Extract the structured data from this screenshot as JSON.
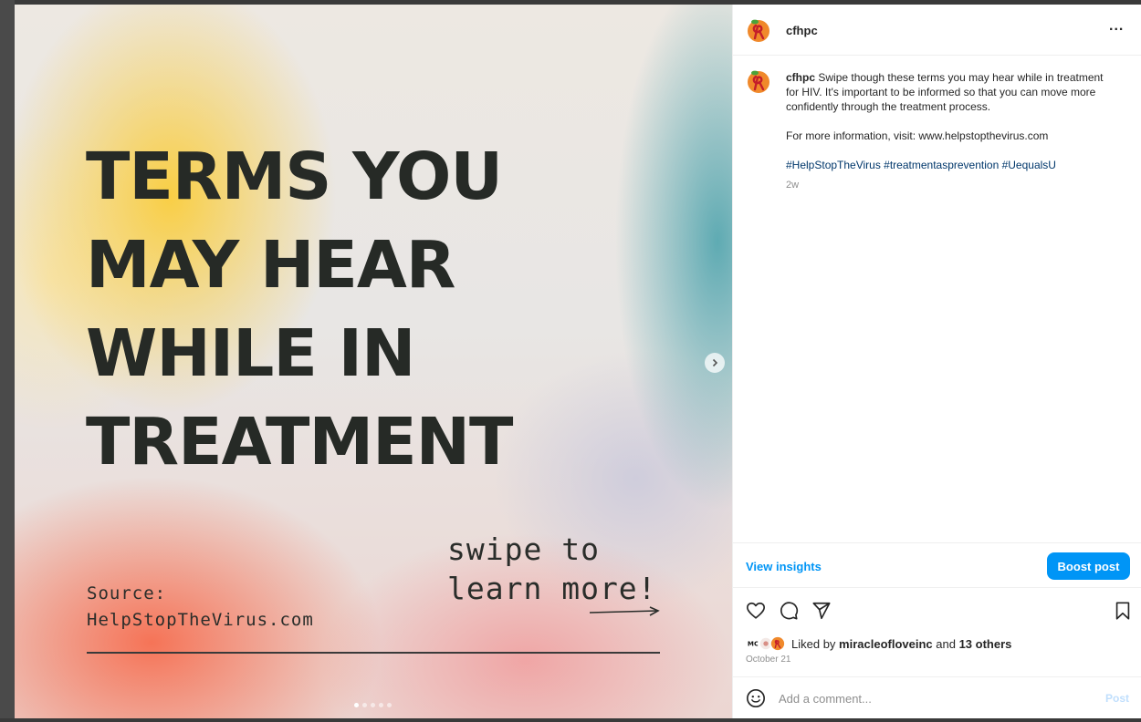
{
  "media": {
    "headline_lines": [
      "TERMS YOU",
      "MAY HEAR",
      "WHILE IN",
      "TREATMENT"
    ],
    "source_label": "Source:",
    "source_site": "HelpStopTheVirus.com",
    "swipe_lines": [
      "swipe to",
      "learn more!"
    ],
    "carousel_count": 5,
    "carousel_active": 1
  },
  "post": {
    "username": "cfhpc",
    "more_label": "...",
    "caption_user": "cfhpc",
    "caption_text": "Swipe though these terms you may hear while in treatment for HIV. It's important to be informed so that you can move more confidently through the treatment process.",
    "caption_info": "For more information, visit: www.helpstopthevirus.com",
    "hashtags": "#HelpStopTheVirus #treatmentasprevention #UequalsU",
    "time_ago": "2w"
  },
  "insights": {
    "view_label": "View insights",
    "boost_label": "Boost post"
  },
  "likes": {
    "prefix": "Liked by ",
    "user": "miracleofloveinc",
    "middle": " and ",
    "others": "13 others"
  },
  "date": "October 21",
  "comment": {
    "placeholder": "Add a comment...",
    "post_label": "Post"
  },
  "colors": {
    "accent": "#0095f6",
    "hashtag": "#00376b",
    "headline": "#262a26"
  },
  "icons": [
    "heart-icon",
    "comment-icon",
    "share-icon",
    "bookmark-icon",
    "emoji-icon",
    "chevron-right-icon",
    "more-icon"
  ]
}
